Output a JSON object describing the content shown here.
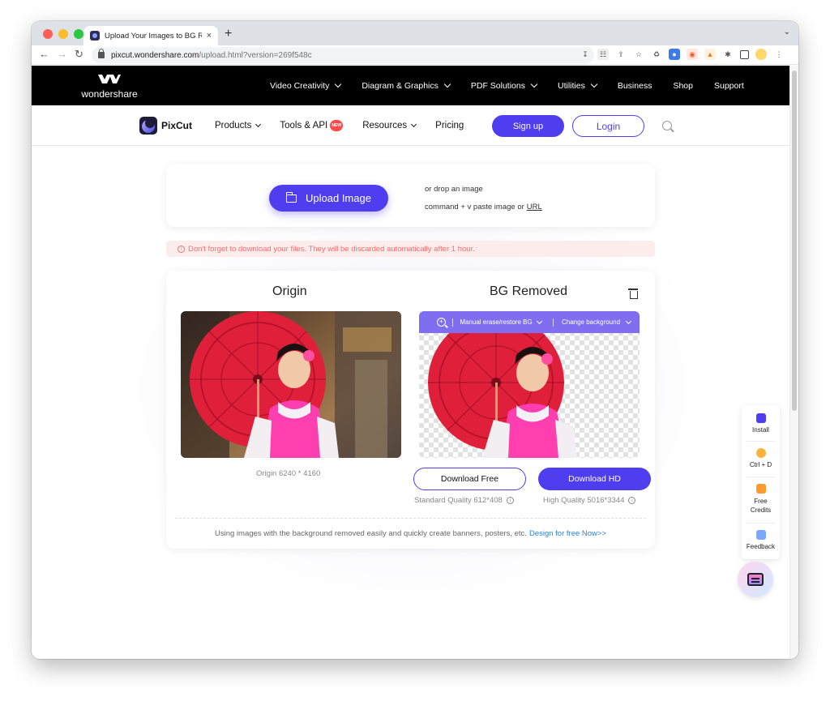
{
  "browser": {
    "tab_title": "Upload Your Images to BG Rem",
    "tab_close": "×",
    "new_tab": "+",
    "url_host": "pixcut.wondershare.com",
    "url_path": "/upload.html?version=269f548c"
  },
  "topnav": {
    "brand": "wondershare",
    "items": [
      "Video Creativity",
      "Diagram & Graphics",
      "PDF Solutions",
      "Utilities",
      "Business",
      "Shop",
      "Support"
    ]
  },
  "pixcut_nav": {
    "brand": "PixCut",
    "items": [
      "Products",
      "Tools & API",
      "Resources",
      "Pricing"
    ],
    "new_badge": "NEW",
    "signup": "Sign up",
    "login": "Login"
  },
  "upload": {
    "button": "Upload Image",
    "drop_text": "or drop an image",
    "paste_text": "command + v paste image or",
    "url_link": "URL"
  },
  "warning": "Don't forget to download your files. They will be discarded automatically after 1 hour.",
  "result": {
    "origin_title": "Origin",
    "removed_title": "BG Removed",
    "tool_erase": "Manual erase/restore BG",
    "tool_change": "Change background",
    "origin_size": "Origin 6240 * 4160",
    "download_free": "Download Free",
    "download_hd": "Download HD",
    "standard_quality": "Standard Quality 612*408",
    "high_quality": "High Quality 5016*3344",
    "promo_text": "Using images with the background removed easily and quickly create banners, posters, etc.",
    "promo_link": "Design for free Now>>"
  },
  "side_panel": {
    "install": "Install",
    "bookmark": "Ctrl + D",
    "credits_line1": "Free",
    "credits_line2": "Credits",
    "feedback": "Feedback"
  },
  "colors": {
    "accent": "#4f3df0",
    "warning_text": "#ff6b6b",
    "link": "#2f7fd6"
  }
}
